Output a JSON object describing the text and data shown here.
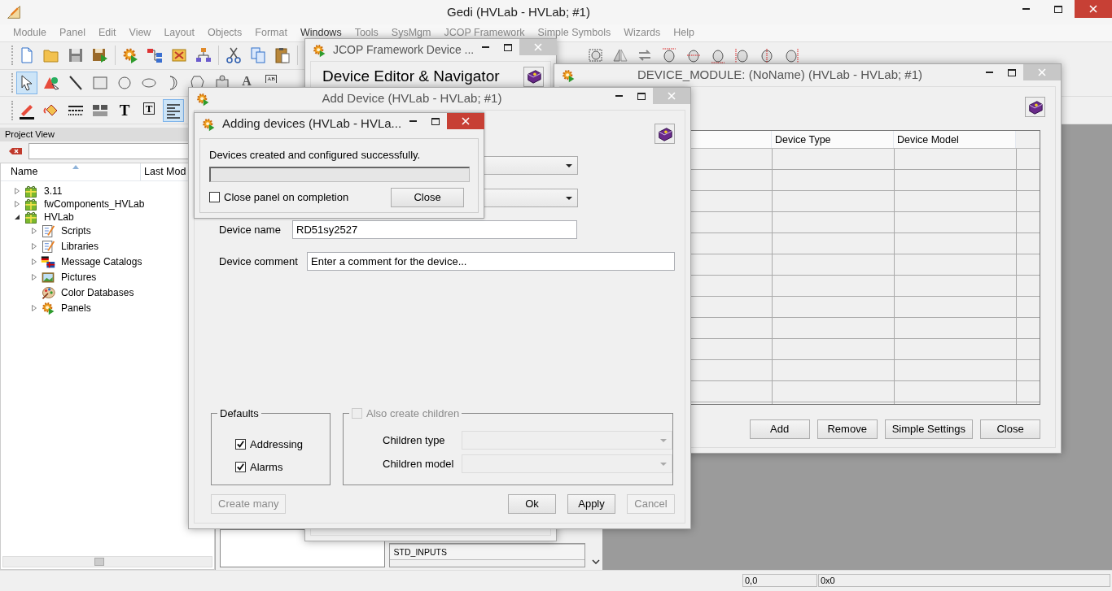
{
  "main_window": {
    "title": "Gedi (HVLab - HVLab; #1)",
    "active": true,
    "menu": [
      {
        "label": "Module",
        "disabled": true
      },
      {
        "label": "Panel",
        "disabled": true
      },
      {
        "label": "Edit",
        "disabled": true
      },
      {
        "label": "View",
        "disabled": true
      },
      {
        "label": "Layout",
        "disabled": true
      },
      {
        "label": "Objects",
        "disabled": true
      },
      {
        "label": "Format",
        "disabled": true
      },
      {
        "label": "Windows",
        "disabled": false
      },
      {
        "label": "Tools",
        "disabled": true
      },
      {
        "label": "SysMgm",
        "disabled": true
      },
      {
        "label": "JCOP Framework",
        "disabled": true
      },
      {
        "label": "Simple Symbols",
        "disabled": true
      },
      {
        "label": "Wizards",
        "disabled": true
      },
      {
        "label": "Help",
        "disabled": true
      }
    ],
    "toolbars": [
      {
        "groups": [
          [
            {
              "kind": "new",
              "selected": false
            },
            {
              "kind": "open",
              "selected": false
            },
            {
              "kind": "save",
              "selected": false
            },
            {
              "kind": "saverun",
              "selected": false
            }
          ],
          [
            {
              "kind": "gear",
              "selected": false
            },
            {
              "kind": "tree",
              "selected": false
            },
            {
              "kind": "tools",
              "selected": false
            },
            {
              "kind": "hierarchy",
              "selected": false
            }
          ],
          [
            {
              "kind": "cut",
              "selected": false
            },
            {
              "kind": "copy",
              "selected": false
            },
            {
              "kind": "paste",
              "selected": false
            }
          ],
          [
            {
              "kind": "group",
              "selected": false
            },
            {
              "kind": "flip",
              "selected": false
            },
            {
              "kind": "rotate",
              "selected": false
            },
            {
              "kind": "align-top",
              "selected": false
            },
            {
              "kind": "align-middle",
              "selected": false
            },
            {
              "kind": "align-bottom",
              "selected": false
            },
            {
              "kind": "align-left",
              "selected": false
            },
            {
              "kind": "align-center",
              "selected": false
            },
            {
              "kind": "align-right",
              "selected": false
            }
          ]
        ]
      },
      {
        "groups": [
          [
            {
              "kind": "select",
              "selected": true
            },
            {
              "kind": "shapes",
              "selected": false
            },
            {
              "kind": "line",
              "selected": false
            },
            {
              "kind": "rect",
              "selected": false
            },
            {
              "kind": "circle",
              "selected": false
            },
            {
              "kind": "ellipse",
              "selected": false
            },
            {
              "kind": "arc",
              "selected": false
            },
            {
              "kind": "polygon",
              "selected": false
            },
            {
              "kind": "cluster",
              "selected": false
            },
            {
              "kind": "text",
              "glyph": "A",
              "selected": false
            },
            {
              "kind": "label",
              "glyph": "AB",
              "selected": false
            }
          ]
        ]
      },
      {
        "groups": [
          [
            {
              "kind": "pen",
              "selected": false
            },
            {
              "kind": "fill",
              "selected": false
            },
            {
              "kind": "linestyle",
              "selected": false
            },
            {
              "kind": "pattern",
              "selected": false
            },
            {
              "kind": "bold-text",
              "glyph": "T",
              "selected": false
            },
            {
              "kind": "textbox",
              "glyph": "T",
              "selected": false
            },
            {
              "kind": "textalign",
              "selected": true
            }
          ]
        ]
      }
    ],
    "project_view": {
      "title": "Project View",
      "columns": [
        "Name",
        "Last Mod"
      ],
      "tree": [
        {
          "label": "3.11",
          "kind": "project",
          "expanded": false
        },
        {
          "label": "fwComponents_HVLab",
          "kind": "project",
          "expanded": false
        },
        {
          "label": "HVLab",
          "kind": "project",
          "expanded": true,
          "children": [
            {
              "label": "Scripts",
              "kind": "scripts",
              "expanded": false
            },
            {
              "label": "Libraries",
              "kind": "libraries",
              "expanded": false
            },
            {
              "label": "Message Catalogs",
              "kind": "catalogs",
              "expanded": false
            },
            {
              "label": "Pictures",
              "kind": "pictures",
              "expanded": false
            },
            {
              "label": "Color Databases",
              "kind": "colors"
            },
            {
              "label": "Panels",
              "kind": "panels",
              "expanded": false
            }
          ]
        }
      ]
    },
    "panel_list": {
      "items": [
        "STD_INPUTS"
      ]
    },
    "status_bar": {
      "fields": [
        "0,0",
        "0x0"
      ]
    }
  },
  "jcop_window": {
    "title": "JCOP Framework Device ...",
    "active": false,
    "heading": "Device Editor & Navigator"
  },
  "device_module_window": {
    "title": "DEVICE_MODULE: (NoName) (HVLab - HVLab; #1)",
    "active": false,
    "columns": [
      "Device Type",
      "Device Model"
    ],
    "buttons": [
      "Add",
      "Remove",
      "Simple Settings",
      "Close"
    ]
  },
  "add_device_window": {
    "title": "Add Device (HVLab - HVLab; #1)",
    "active": false,
    "fields": [
      {
        "label": "Device name",
        "value": "RD51sy2527"
      },
      {
        "label": "Device comment",
        "value": "Enter a comment for the device..."
      }
    ],
    "defaults": {
      "title": "Defaults",
      "options": [
        {
          "label": "Addressing",
          "checked": true
        },
        {
          "label": "Alarms",
          "checked": true
        }
      ]
    },
    "children": {
      "label": "Also create children",
      "checked": false,
      "disabled": true,
      "fields": [
        {
          "label": "Children type"
        },
        {
          "label": "Children model"
        }
      ]
    },
    "buttons": [
      {
        "label": "Create many",
        "disabled": true
      },
      {
        "label": "Ok",
        "disabled": false
      },
      {
        "label": "Apply",
        "disabled": false
      },
      {
        "label": "Cancel",
        "disabled": true
      }
    ]
  },
  "adding_devices_window": {
    "title": "Adding devices (HVLab - HVLa...",
    "active": true,
    "message": "Devices created and configured successfully.",
    "progress": {
      "level": 0
    },
    "close_on_completion": {
      "label": "Close panel on completion",
      "checked": false
    },
    "button": "Close"
  }
}
